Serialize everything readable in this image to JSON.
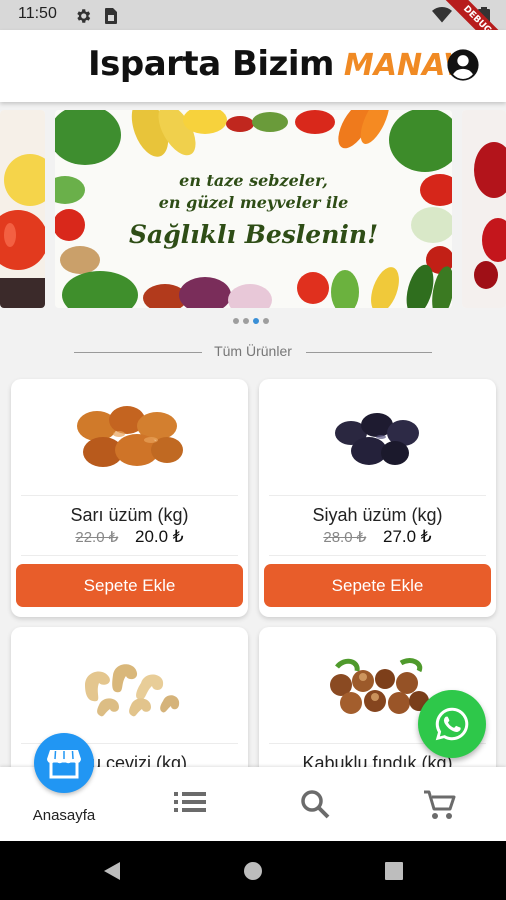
{
  "status_bar": {
    "time": "11:50",
    "icons": [
      "gear-icon",
      "sim-card-icon",
      "wifi-icon",
      "battery-icon"
    ],
    "debug_label": "DEBUG"
  },
  "header": {
    "logo_text": "Isparta Bizim",
    "logo_accent": "MANAV",
    "account_icon": "account-circle-icon"
  },
  "banner": {
    "line1": "en taze sebzeler,",
    "line2": "en güzel meyveler ile",
    "line3": "Sağlıklı Beslenin!",
    "page_count": 4,
    "active_page": 3
  },
  "section": {
    "title": "Tüm Ürünler"
  },
  "products": [
    {
      "name": "Sarı üzüm (kg)",
      "old_price": "22.0 ₺",
      "price": "20.0 ₺",
      "button": "Sepete Ekle"
    },
    {
      "name": "Siyah üzüm (kg)",
      "old_price": "28.0 ₺",
      "price": "27.0 ₺",
      "button": "Sepete Ekle"
    },
    {
      "name": "Kaju cevizi (kg)",
      "visible_name": "u cevizi (kg)"
    },
    {
      "name": "Kabuklu fındık (kg)"
    }
  ],
  "bottom_nav": {
    "items": [
      {
        "label": "Anasayfa",
        "icon": "store-icon"
      },
      {
        "label": "",
        "icon": "list-icon"
      },
      {
        "label": "",
        "icon": "search-icon"
      },
      {
        "label": "",
        "icon": "cart-icon"
      }
    ]
  },
  "colors": {
    "accent_orange": "#e85d2a",
    "logo_orange": "#f08a24",
    "nav_blue": "#2196f3",
    "whatsapp_green": "#2ec84a"
  }
}
